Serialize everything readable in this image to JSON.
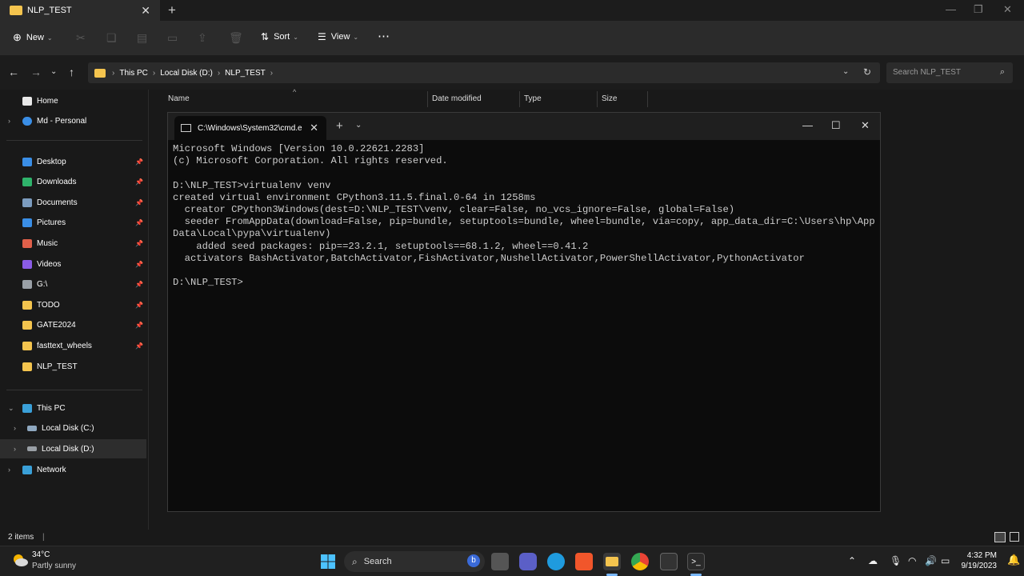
{
  "explorer": {
    "tab_title": "NLP_TEST",
    "commands": {
      "new": "New",
      "sort": "Sort",
      "view": "View",
      "more": "⋯"
    },
    "breadcrumb": [
      "This PC",
      "Local Disk (D:)",
      "NLP_TEST"
    ],
    "search_placeholder": "Search NLP_TEST",
    "columns": [
      "Name",
      "Date modified",
      "Type",
      "Size"
    ],
    "status": "2 items",
    "sidebar": {
      "home": "Home",
      "onedrive": "Md - Personal",
      "quick_access": [
        {
          "label": "Desktop",
          "icon": "desktop-icon",
          "color": "#3a8ee6"
        },
        {
          "label": "Downloads",
          "icon": "downloads-icon",
          "color": "#2fb36b"
        },
        {
          "label": "Documents",
          "icon": "documents-icon",
          "color": "#7c9cbf"
        },
        {
          "label": "Pictures",
          "icon": "pictures-icon",
          "color": "#3a8ee6"
        },
        {
          "label": "Music",
          "icon": "music-icon",
          "color": "#e0604a"
        },
        {
          "label": "Videos",
          "icon": "videos-icon",
          "color": "#8a5ce6"
        },
        {
          "label": "G:\\",
          "icon": "drive-icon",
          "color": "#9aa0a6"
        },
        {
          "label": "TODO",
          "icon": "folder-icon",
          "color": "#f4c44e"
        },
        {
          "label": "GATE2024",
          "icon": "folder-icon",
          "color": "#f4c44e"
        },
        {
          "label": "fasttext_wheels",
          "icon": "folder-icon",
          "color": "#f4c44e"
        },
        {
          "label": "NLP_TEST",
          "icon": "folder-icon",
          "color": "#f4c44e"
        }
      ],
      "this_pc": "This PC",
      "drives": [
        "Local Disk (C:)",
        "Local Disk (D:)"
      ],
      "network": "Network"
    }
  },
  "cmd": {
    "tab_title": "C:\\Windows\\System32\\cmd.e",
    "lines": [
      "Microsoft Windows [Version 10.0.22621.2283]",
      "(c) Microsoft Corporation. All rights reserved.",
      "",
      "D:\\NLP_TEST>virtualenv venv",
      "created virtual environment CPython3.11.5.final.0-64 in 1258ms",
      "  creator CPython3Windows(dest=D:\\NLP_TEST\\venv, clear=False, no_vcs_ignore=False, global=False)",
      "  seeder FromAppData(download=False, pip=bundle, setuptools=bundle, wheel=bundle, via=copy, app_data_dir=C:\\Users\\hp\\App",
      "Data\\Local\\pypa\\virtualenv)",
      "    added seed packages: pip==23.2.1, setuptools==68.1.2, wheel==0.41.2",
      "  activators BashActivator,BatchActivator,FishActivator,NushellActivator,PowerShellActivator,PythonActivator",
      "",
      "D:\\NLP_TEST>"
    ]
  },
  "taskbar": {
    "weather_temp": "34°C",
    "weather_desc": "Partly sunny",
    "search_label": "Search",
    "time": "4:32 PM",
    "date": "9/19/2023"
  }
}
